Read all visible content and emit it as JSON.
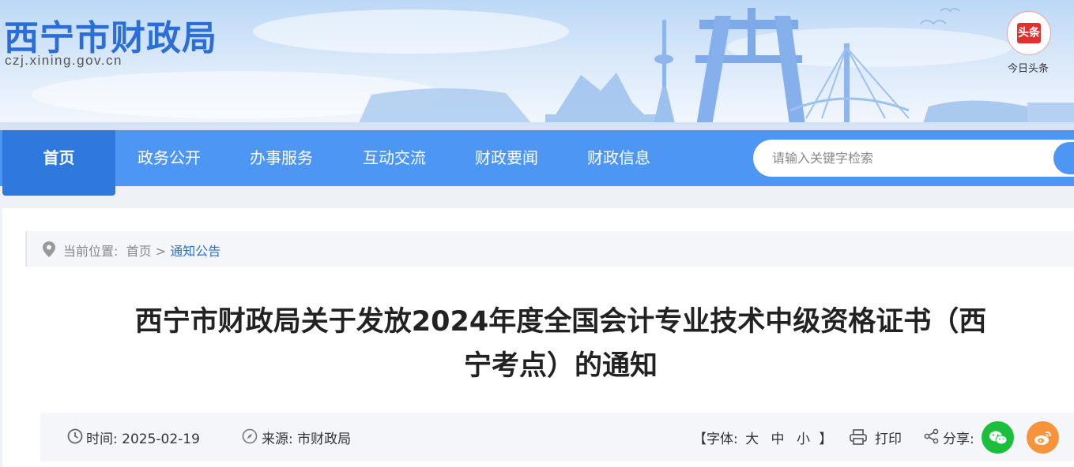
{
  "header": {
    "site_title": "西宁市财政局",
    "site_domain": "czj.xining.gov.cn",
    "toutiao_badge": "头条",
    "toutiao_label": "今日头条"
  },
  "nav": {
    "items": [
      "首页",
      "政务公开",
      "办事服务",
      "互动交流",
      "财政要闻",
      "财政信息"
    ],
    "search_placeholder": "请输入关键字检索"
  },
  "breadcrumb": {
    "prefix": "当前位置:",
    "home": "首页",
    "separator": ">",
    "current": "通知公告"
  },
  "article": {
    "title_line1": "西宁市财政局关于发放2024年度全国会计专业技术中级资格证书（西",
    "title_line2": "宁考点）的通知",
    "time_label": "时间:",
    "time_value": "2025-02-19",
    "source_label": "来源:",
    "source_value": "市财政局",
    "font_label": "【字体:",
    "font_large": "大",
    "font_medium": "中",
    "font_small": "小",
    "font_close": "】",
    "print_label": "打印",
    "share_label": "分享:"
  },
  "colors": {
    "nav_bg": "#4d96f3",
    "nav_active": "#2f79de",
    "accent": "#2b6fd6",
    "wechat": "#1bbf3c",
    "weibo": "#f7933b"
  },
  "icons": [
    "location-pin-icon",
    "clock-icon",
    "compass-icon",
    "printer-icon",
    "share-icon",
    "wechat-icon",
    "weibo-icon",
    "toutiao-icon"
  ]
}
